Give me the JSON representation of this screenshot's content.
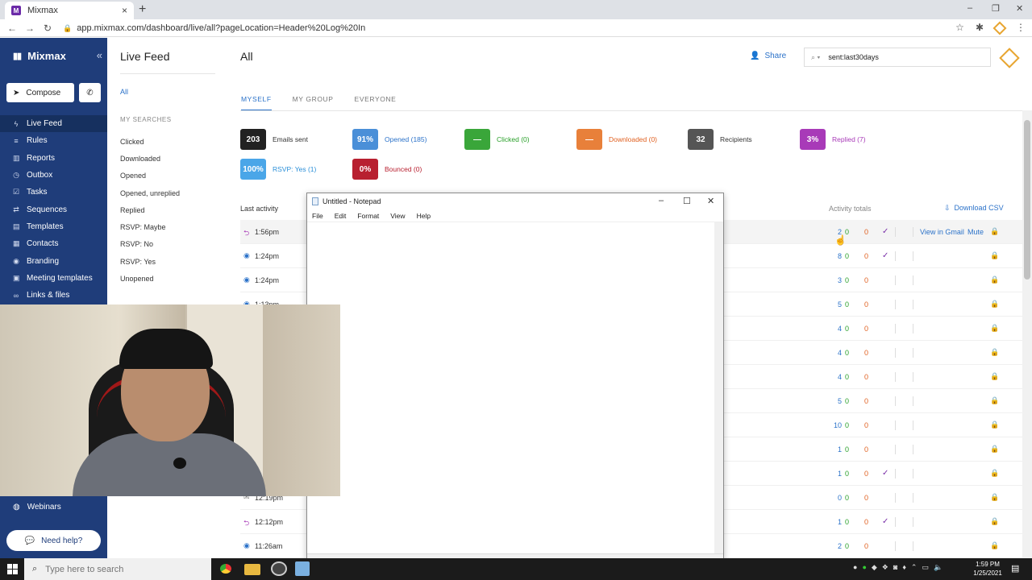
{
  "browser": {
    "tab_title": "Mixmax",
    "favicon_text": "M",
    "new_tab": "+",
    "url": "app.mixmax.com/dashboard/live/all?pageLocation=Header%20Log%20In"
  },
  "sidebar": {
    "brand": "Mixmax",
    "compose_label": "Compose",
    "items": [
      {
        "label": "Live Feed",
        "icon": "live-feed-icon"
      },
      {
        "label": "Rules",
        "icon": "rules-icon"
      },
      {
        "label": "Reports",
        "icon": "reports-icon"
      },
      {
        "label": "Outbox",
        "icon": "outbox-icon"
      },
      {
        "label": "Tasks",
        "icon": "tasks-icon"
      },
      {
        "label": "Sequences",
        "icon": "sequences-icon"
      },
      {
        "label": "Templates",
        "icon": "templates-icon"
      },
      {
        "label": "Contacts",
        "icon": "contacts-icon"
      },
      {
        "label": "Branding",
        "icon": "branding-icon"
      },
      {
        "label": "Meeting templates",
        "icon": "meeting-templates-icon"
      },
      {
        "label": "Links & files",
        "icon": "links-icon"
      }
    ],
    "webinars_label": "Webinars",
    "need_help_label": "Need help?"
  },
  "live_feed": {
    "title": "Live Feed",
    "all_link": "All",
    "my_searches_heading": "MY SEARCHES",
    "searches": [
      "Clicked",
      "Downloaded",
      "Opened",
      "Opened, unreplied",
      "Replied",
      "RSVP: Maybe",
      "RSVP: No",
      "RSVP: Yes",
      "Unopened"
    ]
  },
  "main": {
    "title": "All",
    "share_label": "Share",
    "search_value": "sent:last30days",
    "tabs": [
      "MYSELF",
      "MY GROUP",
      "EVERYONE"
    ],
    "stats": [
      {
        "value": "203",
        "label": "Emails sent",
        "color": "#222222",
        "label_color": "#333333"
      },
      {
        "value": "91%",
        "label": "Opened (185)",
        "color": "#4a8fd8",
        "label_color": "#2b72c9"
      },
      {
        "value": "—",
        "label": "Clicked (0)",
        "color": "#3aa63a",
        "label_color": "#2aa02a"
      },
      {
        "value": "—",
        "label": "Downloaded (0)",
        "color": "#e8803a",
        "label_color": "#e06020"
      },
      {
        "value": "32",
        "label": "Recipients",
        "color": "#555555",
        "label_color": "#333333"
      },
      {
        "value": "3%",
        "label": "Replied (7)",
        "color": "#a83ab8",
        "label_color": "#a83ab8"
      },
      {
        "value": "100%",
        "label": "RSVP: Yes (1)",
        "color": "#4aa6e8",
        "label_color": "#2b8fd8"
      },
      {
        "value": "0%",
        "label": "Bounced (0)",
        "color": "#b82030",
        "label_color": "#b82030"
      }
    ],
    "last_activity_header": "Last activity",
    "activity_totals_header": "Activity totals",
    "download_csv_label": "Download CSV",
    "view_in_gmail": "View in Gmail",
    "mute": "Mute",
    "rows": [
      {
        "time": "1:56pm",
        "icon": "reply-icon",
        "opens": "2",
        "clicks": "0",
        "downloads": "0",
        "replied": "✓"
      },
      {
        "time": "1:24pm",
        "icon": "eye-icon",
        "opens": "8",
        "clicks": "0",
        "downloads": "0",
        "replied": "✓"
      },
      {
        "time": "1:24pm",
        "icon": "eye-icon",
        "opens": "3",
        "clicks": "0",
        "downloads": "0",
        "replied": ""
      },
      {
        "time": "1:13pm",
        "icon": "eye-icon",
        "opens": "5",
        "clicks": "0",
        "downloads": "0",
        "replied": ""
      },
      {
        "time": "",
        "icon": "",
        "opens": "4",
        "clicks": "0",
        "downloads": "0",
        "replied": ""
      },
      {
        "time": "",
        "icon": "",
        "opens": "4",
        "clicks": "0",
        "downloads": "0",
        "replied": ""
      },
      {
        "time": "",
        "icon": "",
        "opens": "4",
        "clicks": "0",
        "downloads": "0",
        "replied": ""
      },
      {
        "time": "",
        "icon": "",
        "opens": "5",
        "clicks": "0",
        "downloads": "0",
        "replied": ""
      },
      {
        "time": "",
        "icon": "",
        "opens": "10",
        "clicks": "0",
        "downloads": "0",
        "replied": ""
      },
      {
        "time": "",
        "icon": "",
        "opens": "1",
        "clicks": "0",
        "downloads": "0",
        "replied": ""
      },
      {
        "time": "",
        "icon": "",
        "opens": "1",
        "clicks": "0",
        "downloads": "0",
        "replied": "✓"
      },
      {
        "time": "12:19pm",
        "icon": "mail-icon",
        "opens": "0",
        "clicks": "0",
        "downloads": "0",
        "replied": ""
      },
      {
        "time": "12:12pm",
        "icon": "reply-icon",
        "opens": "1",
        "clicks": "0",
        "downloads": "0",
        "replied": "✓"
      },
      {
        "time": "11:26am",
        "icon": "eye-icon",
        "opens": "2",
        "clicks": "0",
        "downloads": "0",
        "replied": ""
      }
    ]
  },
  "notepad": {
    "title": "Untitled - Notepad",
    "menu": [
      "File",
      "Edit",
      "Format",
      "View",
      "Help"
    ],
    "content": ""
  },
  "taskbar": {
    "search_placeholder": "Type here to search",
    "time": "1:59 PM",
    "date": "1/25/2021"
  }
}
